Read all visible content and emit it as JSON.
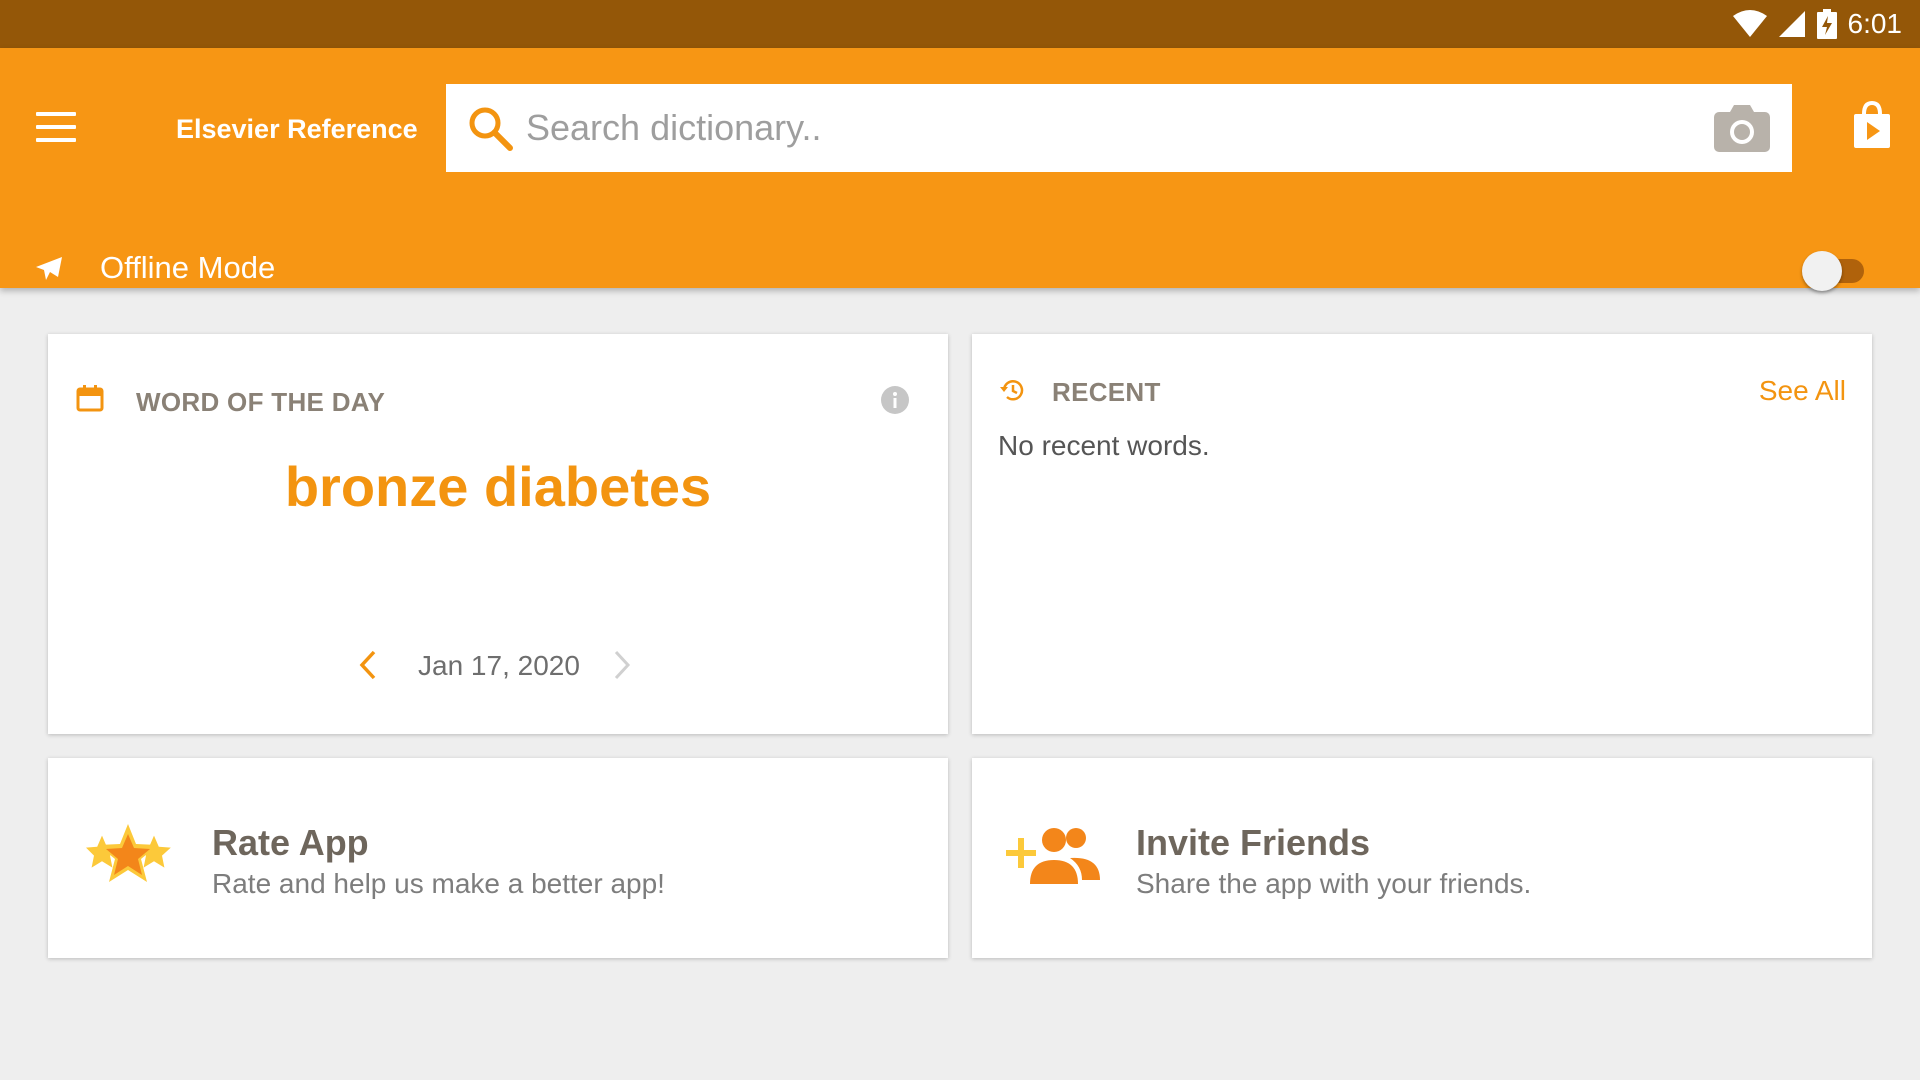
{
  "status_bar": {
    "time": "6:01"
  },
  "app_bar": {
    "title": "Elsevier Reference",
    "search": {
      "placeholder": "Search dictionary..",
      "value": ""
    },
    "offline_mode": {
      "label": "Offline Mode",
      "enabled": false
    }
  },
  "word_of_the_day": {
    "heading": "WORD OF THE DAY",
    "word": "bronze diabetes",
    "date": "Jan 17, 2020"
  },
  "recent": {
    "heading": "RECENT",
    "see_all": "See All",
    "empty_text": "No recent words."
  },
  "rate_app": {
    "title": "Rate App",
    "subtitle": "Rate and help us make a better app!"
  },
  "invite_friends": {
    "title": "Invite Friends",
    "subtitle": "Share the app with your friends."
  },
  "colors": {
    "status_bar": "#945708",
    "app_bar": "#f79614",
    "accent": "#f39410",
    "background": "#eeeeee"
  },
  "icons": [
    "wifi-icon",
    "cell-signal-icon",
    "battery-charging-icon",
    "menu-icon",
    "search-icon",
    "camera-icon",
    "store-icon",
    "airplane-icon",
    "calendar-icon",
    "info-icon",
    "history-icon",
    "chevron-left-icon",
    "chevron-right-icon",
    "star-icon",
    "add-friends-icon"
  ]
}
